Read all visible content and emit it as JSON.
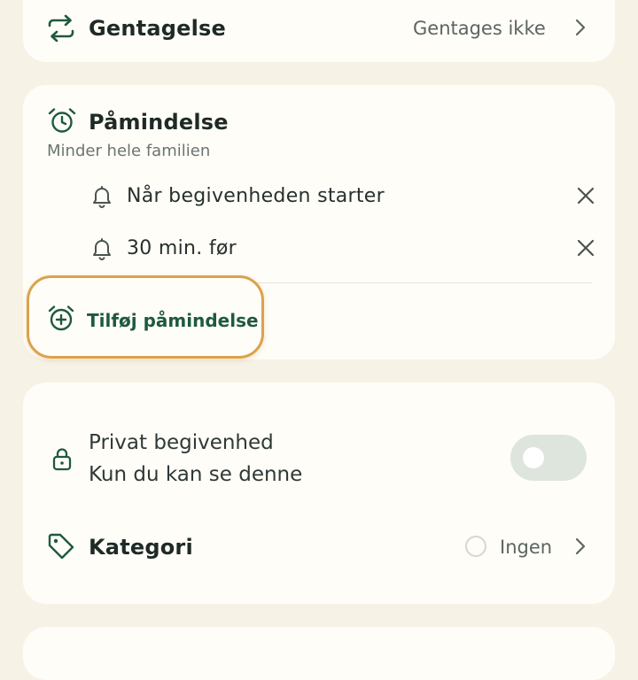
{
  "repeat": {
    "label": "Gentagelse",
    "value": "Gentages ikke",
    "icon": "repeat-icon"
  },
  "reminders": {
    "title": "Påmindelse",
    "subtitle": "Minder hele familien",
    "items": [
      {
        "label": "Når begivenheden starter",
        "icon": "bell-icon"
      },
      {
        "label": "30 min. før",
        "icon": "bell-icon"
      }
    ],
    "add_label": "Tilføj påmindelse",
    "accent_color": "#1e5a3c",
    "highlight_color": "#dba24c"
  },
  "privacy": {
    "title": "Privat begivenhed",
    "subtitle": "Kun du kan se denne",
    "toggle_on": false
  },
  "category": {
    "label": "Kategori",
    "value": "Ingen",
    "icon": "tag-icon"
  }
}
